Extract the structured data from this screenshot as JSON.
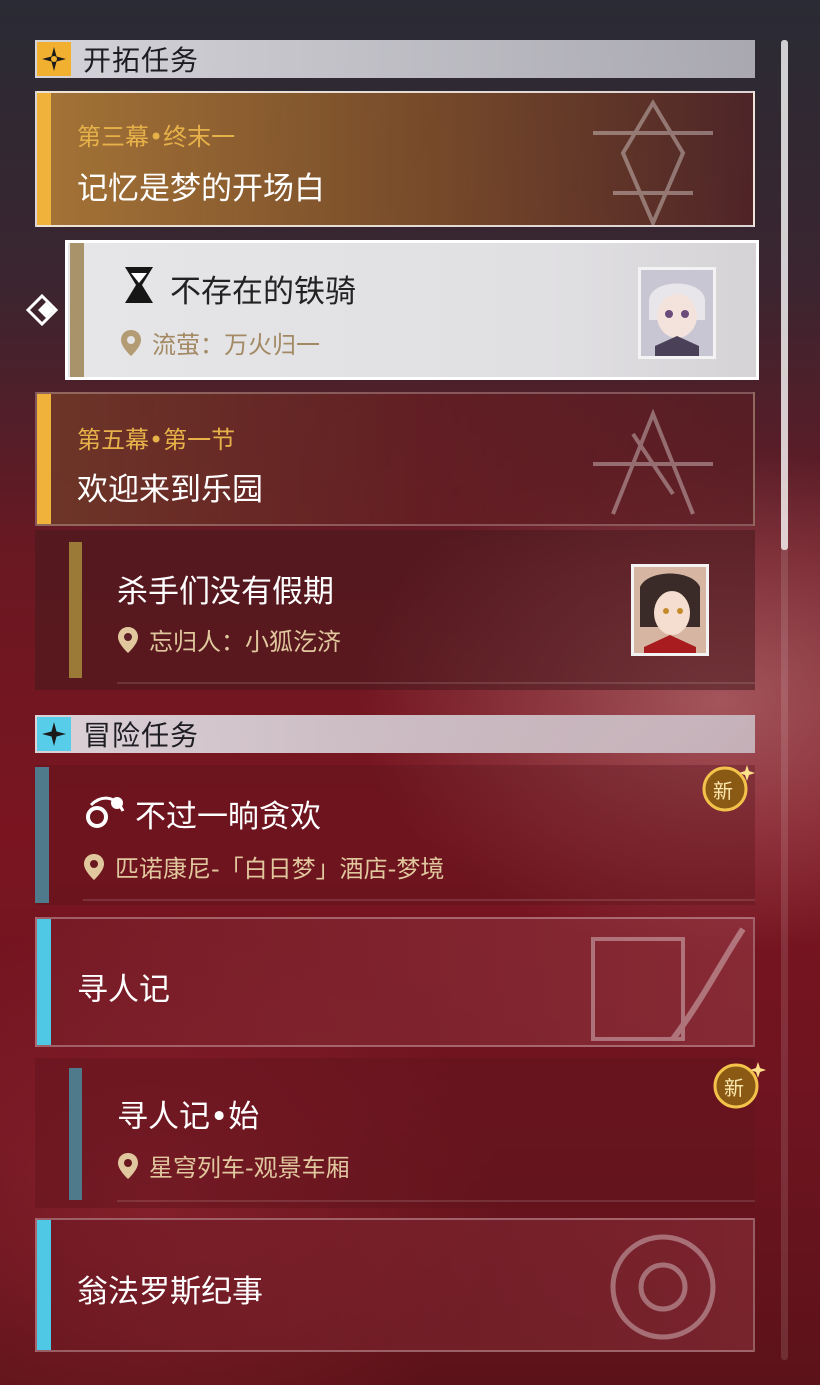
{
  "sections": {
    "trailblaze": {
      "title": "开拓任务"
    },
    "adventure": {
      "title": "冒险任务"
    }
  },
  "missions": [
    {
      "chapter": "第三幕•终末一",
      "name": "记忆是梦的开场白"
    },
    {
      "name": "不存在的铁骑",
      "location": "流萤：万火归一",
      "selected": true
    },
    {
      "chapter": "第五幕•第一节",
      "name": "欢迎来到乐园"
    },
    {
      "name": "杀手们没有假期",
      "location": "忘归人：小狐汔济"
    },
    {
      "name": "不过一晌贪欢",
      "location": "匹诺康尼-「白日梦」酒店-梦境",
      "badge": "新"
    },
    {
      "name": "寻人记"
    },
    {
      "name": "寻人记•始",
      "location": "星穹列车-观景车厢",
      "badge": "新"
    },
    {
      "name": "翁法罗斯纪事"
    }
  ],
  "colors": {
    "gold": "#e7b14a",
    "cyan": "#4fc8e6",
    "slate": "#4f7a8c"
  },
  "icons": {
    "pin": "location-pin-icon",
    "hourglass": "hourglass-icon",
    "orbit": "orbit-icon",
    "trailblaze": "trailblaze-star-icon",
    "adventure": "adventure-star-icon"
  }
}
